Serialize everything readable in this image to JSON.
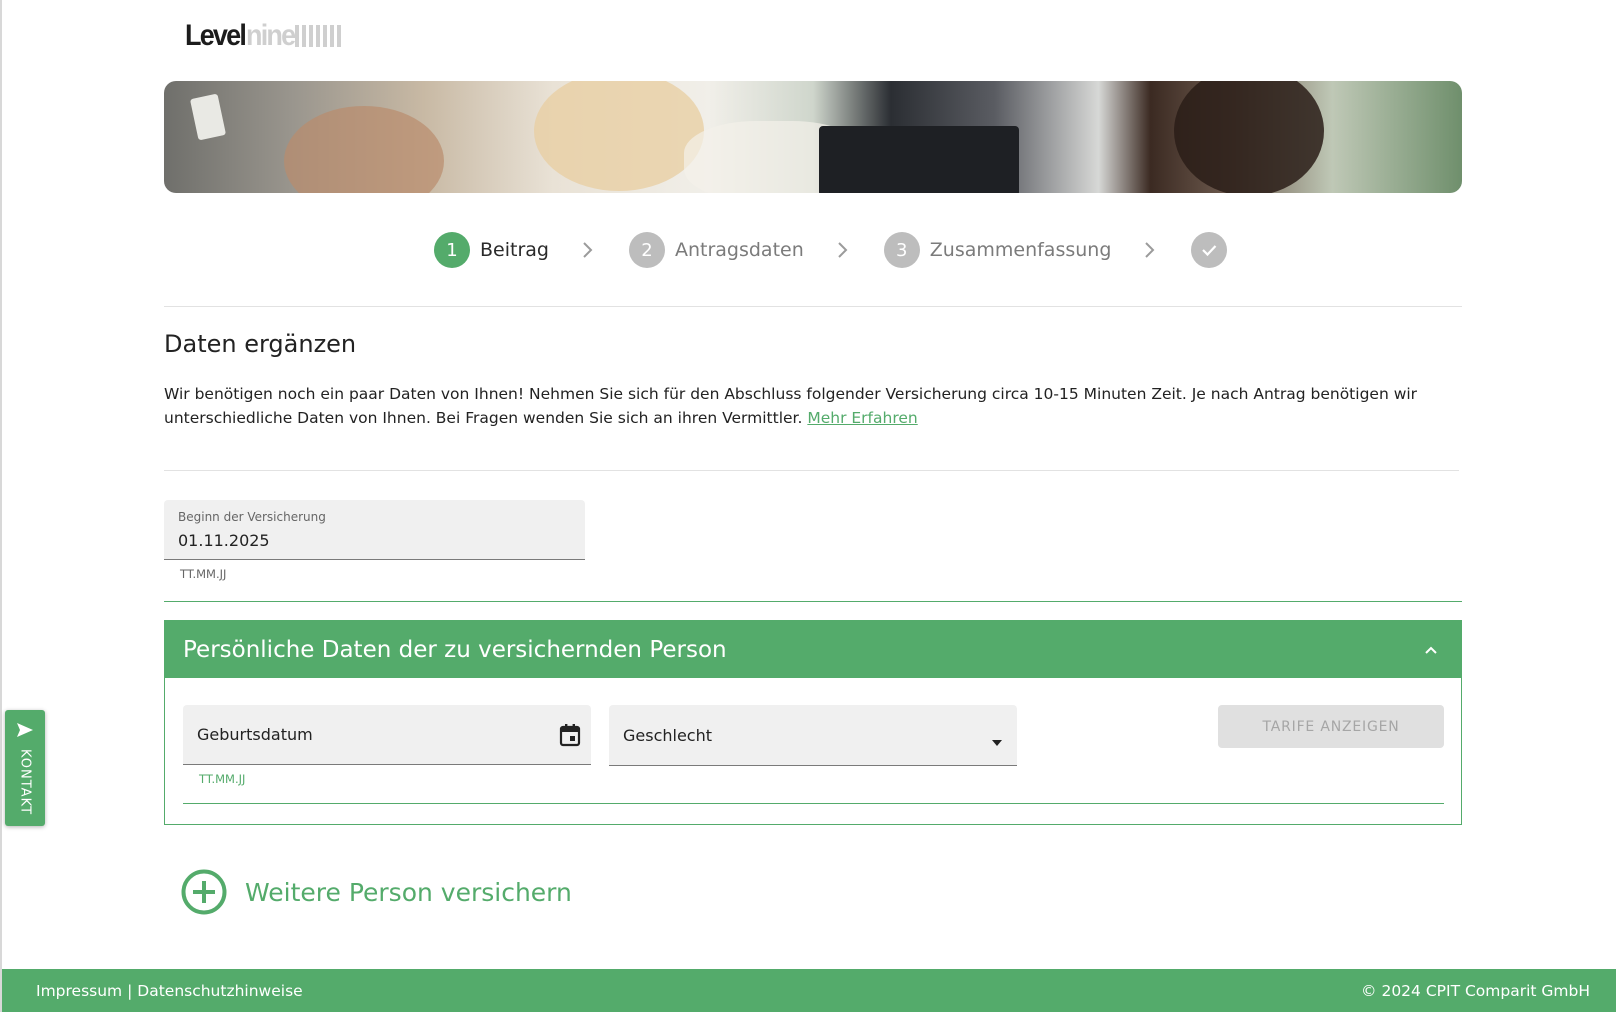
{
  "brand": {
    "logo_dark": "Level",
    "logo_light": "nine"
  },
  "stepper": {
    "steps": [
      {
        "number": "1",
        "label": "Beitrag",
        "state": "active"
      },
      {
        "number": "2",
        "label": "Antragsdaten",
        "state": "inactive"
      },
      {
        "number": "3",
        "label": "Zusammenfassung",
        "state": "inactive"
      },
      {
        "icon": "check-icon",
        "state": "inactive"
      }
    ]
  },
  "intro": {
    "title": "Daten ergänzen",
    "text": "Wir benötigen noch ein paar Daten von Ihnen! Nehmen Sie sich für den Abschluss folgender Versicherung circa 10-15 Minuten Zeit. Je nach Antrag benötigen wir unterschiedliche Daten von Ihnen. Bei Fragen wenden Sie sich an ihren Vermittler.",
    "link": "Mehr Erfahren"
  },
  "start_field": {
    "label": "Beginn der Versicherung",
    "value": "01.11.2025",
    "hint": "TT.MM.JJ"
  },
  "person_panel": {
    "title": "Persönliche Daten der zu versichernden Person",
    "toggle_icon": "chevron-up-icon",
    "birthdate": {
      "placeholder": "Geburtsdatum",
      "hint": "TT.MM.JJ",
      "icon": "calendar-icon"
    },
    "gender": {
      "placeholder": "Geschlecht",
      "icon": "dropdown-arrow-icon"
    },
    "show_rates_button": "TARIFE ANZEIGEN"
  },
  "add_person": {
    "label": "Weitere Person versichern",
    "icon": "add-circle-icon"
  },
  "contact_tab": {
    "label": "KONTAKT",
    "icon": "send-icon"
  },
  "footer": {
    "impressum": "Impressum",
    "separator": "|",
    "privacy": "Datenschutzhinweise",
    "copyright": "© 2024 CPIT Comparit GmbH"
  },
  "colors": {
    "accent": "#54ab6b",
    "disabled_bg": "#e0e0e0",
    "field_bg": "#f0f0f0"
  }
}
